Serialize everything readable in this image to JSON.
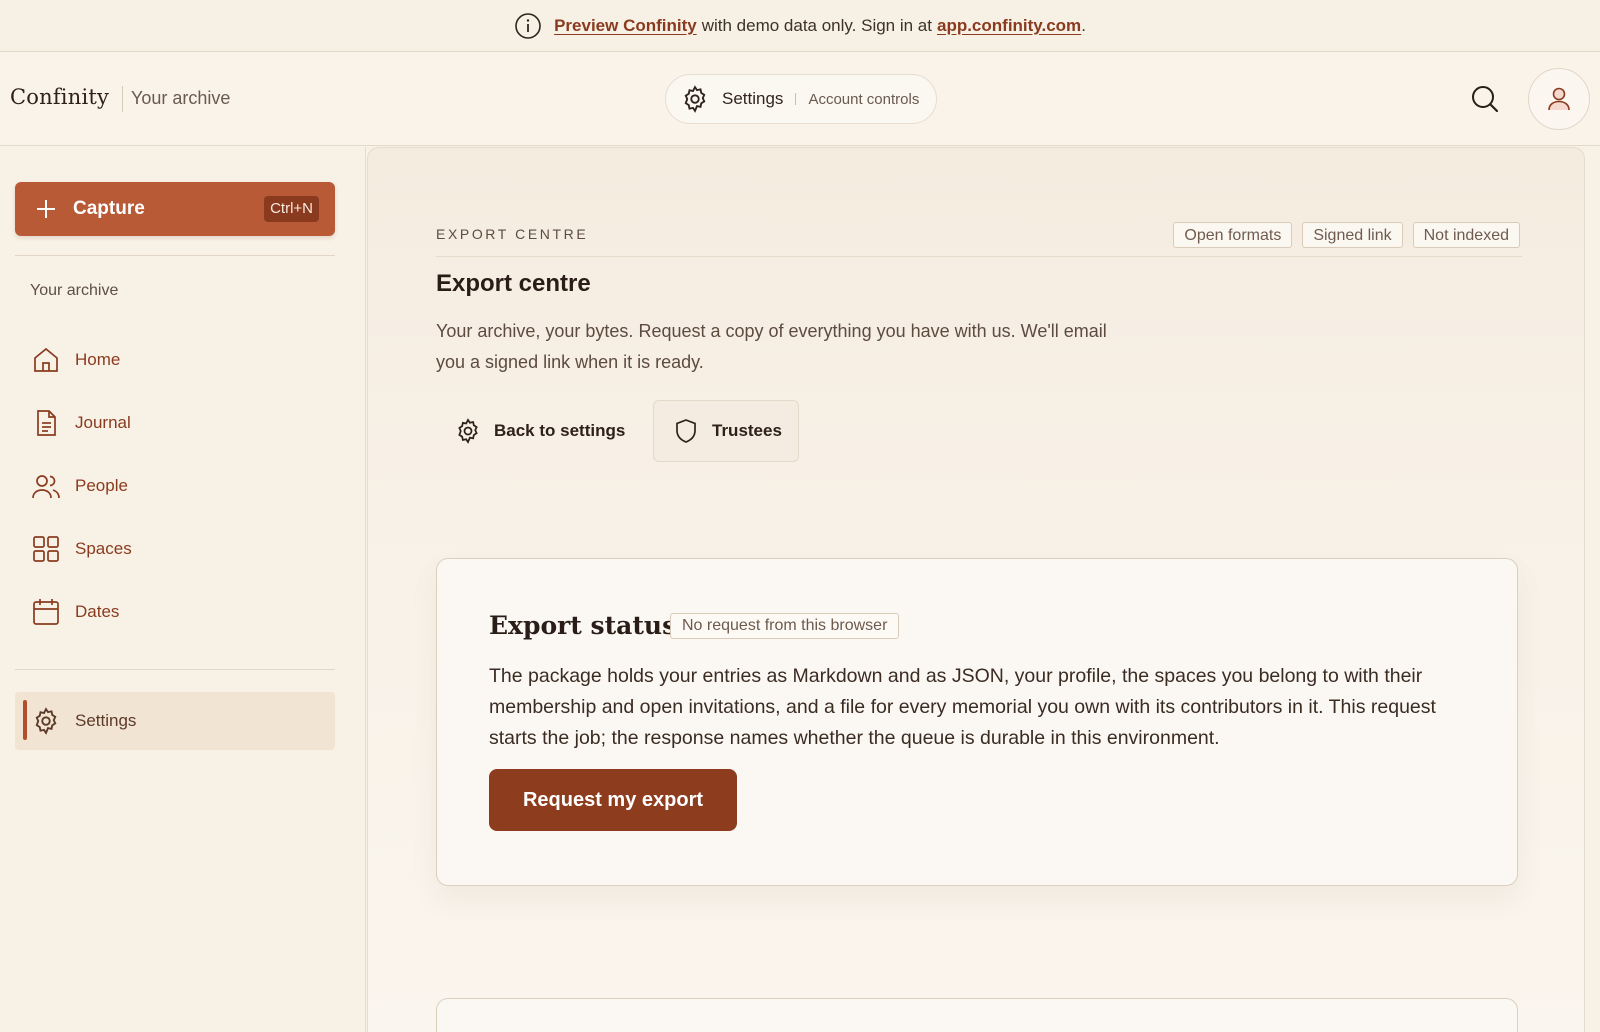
{
  "banner": {
    "preview_link": "Preview Confinity",
    "middle_text": "with demo data only. Sign in at",
    "domain_link": "app.confinity.com",
    "trailing": "."
  },
  "topbar": {
    "brand": "Confinity",
    "brand_sub": "Your archive",
    "pill_label": "Settings",
    "pill_sub": "Account controls"
  },
  "sidebar": {
    "capture_label": "Capture",
    "capture_shortcut": "Ctrl+N",
    "heading": "Your archive",
    "items": [
      {
        "label": "Home",
        "icon": "home-icon"
      },
      {
        "label": "Journal",
        "icon": "document-icon"
      },
      {
        "label": "People",
        "icon": "people-icon"
      },
      {
        "label": "Spaces",
        "icon": "grid-icon"
      },
      {
        "label": "Dates",
        "icon": "calendar-icon"
      }
    ],
    "settings_label": "Settings"
  },
  "main": {
    "eyebrow": "EXPORT CENTRE",
    "tags": [
      "Open formats",
      "Signed link",
      "Not indexed"
    ],
    "title": "Export centre",
    "description": "Your archive, your bytes. Request a copy of everything you have with us. We'll email you a signed link when it is ready.",
    "back_button": "Back to settings",
    "trustees_button": "Trustees"
  },
  "card": {
    "title": "Export status",
    "badge": "No request from this browser",
    "body": "The package holds your entries as Markdown and as JSON, your profile, the spaces you belong to with their membership and open invitations, and a file for every memorial you own with its contributors in it. This request starts the job; the response names whether the queue is durable in this environment.",
    "button": "Request my export"
  },
  "colors": {
    "accent": "#b95a37",
    "accent_dark": "#8e3c1e",
    "background": "#f8f1e6"
  }
}
